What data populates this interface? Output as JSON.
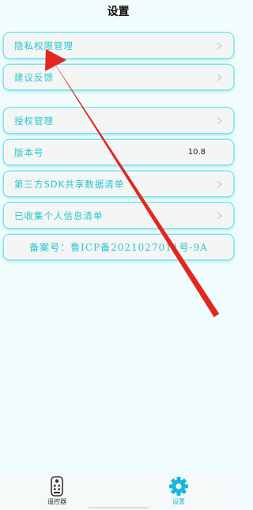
{
  "header": {
    "title": "设置"
  },
  "menu": {
    "privacy": "隐私权限管理",
    "feedback": "建议反馈",
    "auth": "授权管理",
    "version_label": "版本号",
    "version_value": "10.8",
    "sdk_list": "第三方SDK共享数据清单",
    "collected_info": "已收集个人信息清单",
    "icp": "备案号：鲁ICP备2021027011号-9A"
  },
  "tabs": [
    {
      "label": "遥控器",
      "icon": "remote-icon"
    },
    {
      "label": "设置",
      "icon": "gear-icon"
    }
  ],
  "colors": {
    "accent": "#24c7cf",
    "annotation": "#e3261f",
    "tab_active": "#15b9d6"
  }
}
